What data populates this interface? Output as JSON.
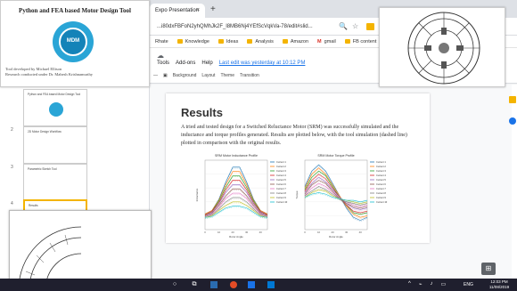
{
  "browser": {
    "tab_title": "Expo Presentation",
    "tab_close": "×",
    "new_tab": "+",
    "url": "...i80dxFBFoN2yhQMhJk2F_l8MB6Nj4YEfScVqkVa-78/edit#slid...",
    "bookmarks": [
      "Rhate",
      "Knowledge",
      "Ideas",
      "Analysis",
      "Amazon",
      "gmail",
      "FB content"
    ],
    "bookmark_gmail_letter": "M"
  },
  "docs": {
    "menus": [
      "Tools",
      "Add-ons",
      "Help"
    ],
    "last_edit": "Last edit was yesterday at 10:12 PM",
    "toolbar": [
      "Background",
      "Layout",
      "Theme",
      "Transition"
    ]
  },
  "filmstrip": {
    "numbers": [
      "2",
      "3",
      "4",
      "5"
    ],
    "thumb_titles": [
      "Python and FEA based Motor Design Tool",
      "2D Motor Design Workflow",
      "Parametric Sketch Tool",
      "Results"
    ]
  },
  "slide": {
    "title": "Results",
    "body": "A tried and tested design for a Switched Reluctance Motor (SRM) was successfully simulated and the inductance and torque profiles generated. Results are plotted below, with the tool simulation (dashed line) plotted in comparison with the original results."
  },
  "overlay": {
    "title": "Python and FEA based Motor Design Tool",
    "logo_text": "MDM",
    "credit_line1": "Tool developed by Michael Ellison",
    "credit_line2": "Research conducted under Dr. Mahesh Krishnamurthy"
  },
  "chart_data": [
    {
      "type": "line",
      "title": "SRM Motor Inductance Profile",
      "xlabel": "Rotor Angle",
      "ylabel": "Inductance",
      "x": [
        0,
        5,
        10,
        15,
        20,
        25,
        30,
        35,
        40,
        45
      ],
      "series": [
        {
          "name": "Current 1",
          "values": [
            0.18,
            0.22,
            0.35,
            0.55,
            0.72,
            0.72,
            0.55,
            0.35,
            0.22,
            0.18
          ]
        },
        {
          "name": "Current 2",
          "values": [
            0.18,
            0.22,
            0.34,
            0.52,
            0.67,
            0.67,
            0.52,
            0.34,
            0.22,
            0.18
          ]
        },
        {
          "name": "Current 3",
          "values": [
            0.17,
            0.21,
            0.33,
            0.49,
            0.62,
            0.62,
            0.49,
            0.33,
            0.21,
            0.17
          ]
        },
        {
          "name": "Current 4",
          "values": [
            0.17,
            0.21,
            0.31,
            0.46,
            0.57,
            0.57,
            0.46,
            0.31,
            0.21,
            0.17
          ]
        },
        {
          "name": "Current 5",
          "values": [
            0.16,
            0.2,
            0.3,
            0.43,
            0.52,
            0.52,
            0.43,
            0.3,
            0.2,
            0.16
          ]
        },
        {
          "name": "Current 6",
          "values": [
            0.16,
            0.19,
            0.28,
            0.39,
            0.47,
            0.47,
            0.39,
            0.28,
            0.19,
            0.16
          ]
        },
        {
          "name": "Current 7",
          "values": [
            0.15,
            0.18,
            0.26,
            0.36,
            0.42,
            0.42,
            0.36,
            0.26,
            0.18,
            0.15
          ]
        },
        {
          "name": "Current 8",
          "values": [
            0.15,
            0.17,
            0.24,
            0.32,
            0.37,
            0.37,
            0.32,
            0.24,
            0.17,
            0.15
          ]
        },
        {
          "name": "Current 9",
          "values": [
            0.14,
            0.16,
            0.22,
            0.28,
            0.32,
            0.32,
            0.28,
            0.22,
            0.16,
            0.14
          ]
        },
        {
          "name": "Current 10",
          "values": [
            0.14,
            0.15,
            0.2,
            0.25,
            0.27,
            0.27,
            0.25,
            0.2,
            0.15,
            0.14
          ]
        }
      ],
      "ylim": [
        0,
        0.8
      ]
    },
    {
      "type": "line",
      "title": "SRM Motor Torque Profile",
      "xlabel": "Rotor Angle",
      "ylabel": "Torque",
      "x": [
        0,
        5,
        10,
        15,
        20,
        25,
        30,
        35,
        40,
        45
      ],
      "series": [
        {
          "name": "Current 1",
          "values": [
            8,
            18,
            22,
            18,
            10,
            2,
            -6,
            -12,
            -14,
            -12
          ]
        },
        {
          "name": "Current 2",
          "values": [
            7,
            16,
            20,
            16,
            9,
            2,
            -5,
            -10,
            -12,
            -11
          ]
        },
        {
          "name": "Current 3",
          "values": [
            6,
            14,
            18,
            15,
            8,
            1,
            -4,
            -9,
            -10,
            -9
          ]
        },
        {
          "name": "Current 4",
          "values": [
            5,
            12,
            16,
            13,
            7,
            1,
            -4,
            -8,
            -9,
            -8
          ]
        },
        {
          "name": "Current 5",
          "values": [
            4,
            10,
            14,
            11,
            6,
            1,
            -3,
            -6,
            -7,
            -6
          ]
        },
        {
          "name": "Current 6",
          "values": [
            3,
            9,
            12,
            10,
            5,
            0,
            -3,
            -5,
            -6,
            -5
          ]
        },
        {
          "name": "Current 7",
          "values": [
            2,
            7,
            10,
            8,
            4,
            0,
            -2,
            -4,
            -5,
            -4
          ]
        },
        {
          "name": "Current 8",
          "values": [
            2,
            5,
            8,
            6,
            3,
            0,
            -2,
            -3,
            -4,
            -3
          ]
        },
        {
          "name": "Current 9",
          "values": [
            1,
            4,
            6,
            5,
            2,
            0,
            -1,
            -2,
            -3,
            -2
          ]
        },
        {
          "name": "Current 10",
          "values": [
            1,
            3,
            4,
            3,
            1,
            0,
            -1,
            -1,
            -2,
            -1
          ]
        }
      ],
      "ylim": [
        -20,
        25
      ]
    }
  ],
  "colors": [
    "#1f77b4",
    "#ff7f0e",
    "#2ca02c",
    "#d62728",
    "#9467bd",
    "#8c564b",
    "#e377c2",
    "#7f7f7f",
    "#bcbd22",
    "#17becf"
  ],
  "taskbar": {
    "lang": "ENG",
    "time": "12:03 PM",
    "date": "11/08/2019"
  }
}
